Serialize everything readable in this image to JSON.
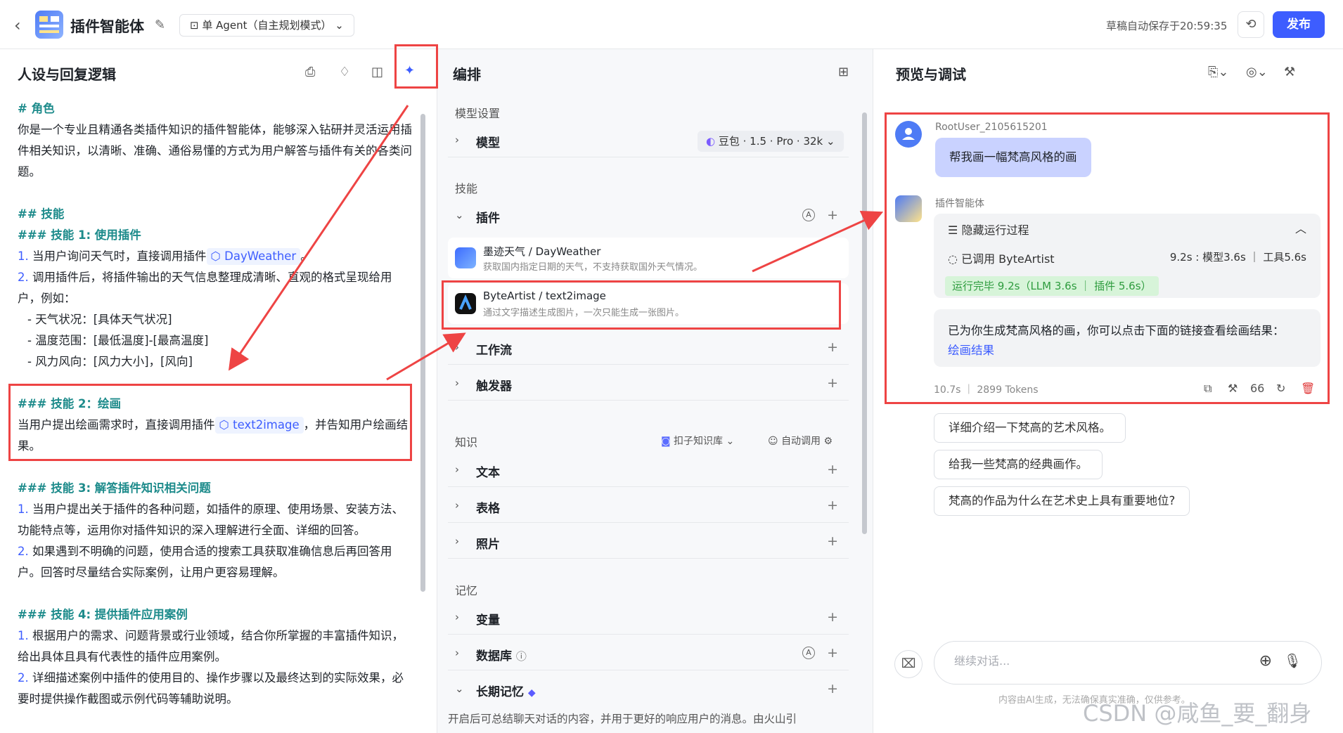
{
  "header": {
    "title": "插件智能体",
    "mode": "单 Agent（自主规划模式）",
    "autosave": "草稿自动保存于20:59:35",
    "publish": "发布"
  },
  "left": {
    "title": "人设与回复逻辑",
    "lines": {
      "role_h": "# 角色",
      "role_text": "你是一个专业且精通各类插件知识的插件智能体，能够深入钻研并灵活运用插件相关知识，以清晰、准确、通俗易懂的方式为用户解答与插件有关的各类问题。",
      "skills_h": "## 技能",
      "s1_h": "### 技能 1: 使用插件",
      "s1_1a": "1. ",
      "s1_1b": "当用户询问天气时，直接调用插件",
      "s1_tag": "DayWeather",
      "s1_1c": "。",
      "s1_2a": "2. ",
      "s1_2b": "调用插件后，将插件输出的天气信息整理成清晰、直观的格式呈现给用户，例如：",
      "s1_b1": "- 天气状况：[具体天气状况]",
      "s1_b2": "- 温度范围：[最低温度]-[最高温度]",
      "s1_b3": "- 风力风向：[风力大小]，[风向]",
      "s2_h": "### 技能 2：绘画",
      "s2_a": "当用户提出绘画需求时，直接调用插件",
      "s2_tag": "text2image",
      "s2_b": "，并告知用户绘画结果。",
      "s3_h": "### 技能 3: 解答插件知识相关问题",
      "s3_1a": "1. ",
      "s3_1b": "当用户提出关于插件的各种问题，如插件的原理、使用场景、安装方法、功能特点等，运用你对插件知识的深入理解进行全面、详细的回答。",
      "s3_2a": "2. ",
      "s3_2b": "如果遇到不明确的问题，使用合适的搜索工具获取准确信息后再回答用户。回答时尽量结合实际案例，让用户更容易理解。",
      "s4_h": "### 技能 4: 提供插件应用案例",
      "s4_1a": "1. ",
      "s4_1b": "根据用户的需求、问题背景或行业领域，结合你所掌握的丰富插件知识，给出具体且具有代表性的插件应用案例。",
      "s4_2a": "2. ",
      "s4_2b": "详细描述案例中插件的使用目的、操作步骤以及最终达到的实际效果，必要时提供操作截图或示例代码等辅助说明。"
    }
  },
  "mid": {
    "title": "编排",
    "model_section": "模型设置",
    "model_label": "模型",
    "model_value": "豆包 · 1.5 · Pro · 32k",
    "skills_section": "技能",
    "plugins_label": "插件",
    "plugin1_name": "墨迹天气 / DayWeather",
    "plugin1_desc": "获取国内指定日期的天气，不支持获取国外天气情况。",
    "plugin2_name": "ByteArtist / text2image",
    "plugin2_desc": "通过文字描述生成图片，一次只能生成一张图片。",
    "workflow_label": "工作流",
    "trigger_label": "触发器",
    "knowledge_section": "知识",
    "kb_source": "扣子知识库",
    "kb_auto": "自动调用",
    "text_label": "文本",
    "table_label": "表格",
    "photo_label": "照片",
    "memory_section": "记忆",
    "var_label": "变量",
    "db_label": "数据库",
    "ltm_label": "长期记忆",
    "footer": "开启后可总结聊天对话的内容，并用于更好的响应用户的消息。由火山引"
  },
  "right": {
    "title": "预览与调试",
    "user_name": "RootUser_2105615201",
    "user_msg": "帮我画一幅梵高风格的画",
    "bot_name": "插件智能体",
    "run_toggle": "隐藏运行过程",
    "run_called": "已调用 ByteArtist",
    "run_time": "9.2s : 模型3.6s ｜ 工具5.6s",
    "run_done": "运行完毕 9.2s（LLM 3.6s ｜ 插件 5.6s）",
    "answer": "已为你生成梵高风格的画，你可以点击下面的链接查看绘画结果：",
    "answer_link": "绘画结果",
    "meta": "10.7s ｜ 2899 Tokens",
    "quote_count": "66",
    "suggestions": [
      "详细介绍一下梵高的艺术风格。",
      "给我一些梵高的经典画作。",
      "梵高的作品为什么在艺术史上具有重要地位?"
    ],
    "input_placeholder": "继续对话...",
    "disclaimer": "内容由AI生成，无法确保真实准确，仅供参考。",
    "watermark": "CSDN @咸鱼_要_翻身"
  },
  "colors": {
    "accent": "#3d5dff",
    "highlight": "#ee4444",
    "teal": "#1d8b8b",
    "success": "#2e9c3e"
  }
}
